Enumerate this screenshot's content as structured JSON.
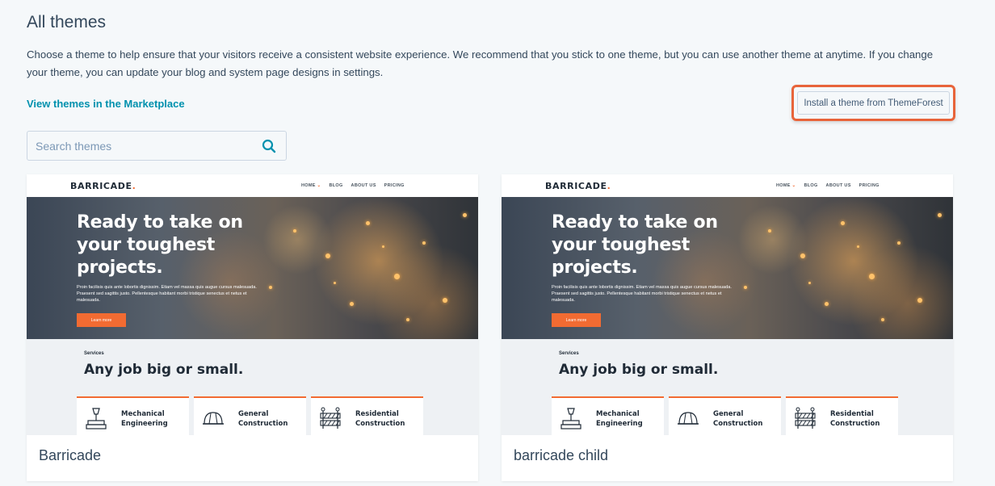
{
  "page": {
    "title": "All themes",
    "description": "Choose a theme to help ensure that your visitors receive a consistent website experience. We recommend that you stick to one theme, but you can use another theme at anytime. If you change your theme, you can update your blog and system page designs in settings.",
    "marketplace_link": "View themes in the Marketplace",
    "install_button": "Install a theme from ThemeForest"
  },
  "search": {
    "placeholder": "Search themes",
    "value": ""
  },
  "colors": {
    "accent": "#f26b32",
    "link": "#0091ae",
    "highlight_border": "#e8643a"
  },
  "themes": [
    {
      "name": "Barricade",
      "preview": {
        "logo": "BARRICADE",
        "logo_dot": ".",
        "nav": [
          "HOME",
          "BLOG",
          "ABOUT US",
          "PRICING"
        ],
        "hero_title": "Ready to take on your toughest projects.",
        "hero_text": "Proin facilisis quis ante lobortis dignissim. Etiam vel massa quis augue cursus malesuada. Praesent sed sagittis justo. Pellentesque habitant morbi tristique senectus et netus et malesuada.",
        "hero_button": "Learn more",
        "services_label": "Services",
        "services_title": "Any job big or small.",
        "services": [
          "Mechanical Engineering",
          "General Construction",
          "Residential Construction"
        ]
      }
    },
    {
      "name": "barricade child",
      "preview": {
        "logo": "BARRICADE",
        "logo_dot": ".",
        "nav": [
          "HOME",
          "BLOG",
          "ABOUT US",
          "PRICING"
        ],
        "hero_title": "Ready to take on your toughest projects.",
        "hero_text": "Proin facilisis quis ante lobortis dignissim. Etiam vel massa quis augue cursus malesuada. Praesent sed sagittis justo. Pellentesque habitant morbi tristique senectus et netus et malesuada.",
        "hero_button": "Learn more",
        "services_label": "Services",
        "services_title": "Any job big or small.",
        "services": [
          "Mechanical Engineering",
          "General Construction",
          "Residential Construction"
        ]
      }
    }
  ]
}
